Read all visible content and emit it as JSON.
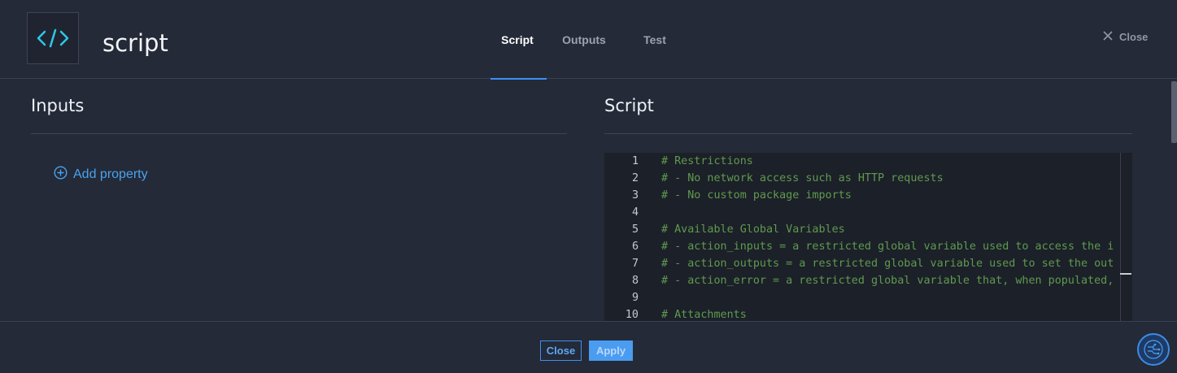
{
  "header": {
    "title": "script",
    "app_icon": "code-icon",
    "tabs": [
      {
        "label": "Script",
        "active": true
      },
      {
        "label": "Outputs",
        "active": false
      },
      {
        "label": "Test",
        "active": false
      }
    ],
    "close_label": "Close"
  },
  "inputs_panel": {
    "title": "Inputs",
    "add_property_label": "Add property"
  },
  "script_panel": {
    "title": "Script",
    "lines": [
      {
        "n": "1",
        "text": "# Restrictions"
      },
      {
        "n": "2",
        "text": "# - No network access such as HTTP requests"
      },
      {
        "n": "3",
        "text": "# - No custom package imports"
      },
      {
        "n": "4",
        "text": ""
      },
      {
        "n": "5",
        "text": "# Available Global Variables"
      },
      {
        "n": "6",
        "text": "# - action_inputs = a restricted global variable used to access the i"
      },
      {
        "n": "7",
        "text": "# - action_outputs = a restricted global variable used to set the out"
      },
      {
        "n": "8",
        "text": "# - action_error = a restricted global variable that, when populated,"
      },
      {
        "n": "9",
        "text": ""
      },
      {
        "n": "10",
        "text": "# Attachments"
      }
    ]
  },
  "footer": {
    "close_label": "Close",
    "apply_label": "Apply"
  },
  "colors": {
    "accent": "#3e8ff5",
    "background": "#242a37",
    "comment": "#5f9a4e"
  }
}
